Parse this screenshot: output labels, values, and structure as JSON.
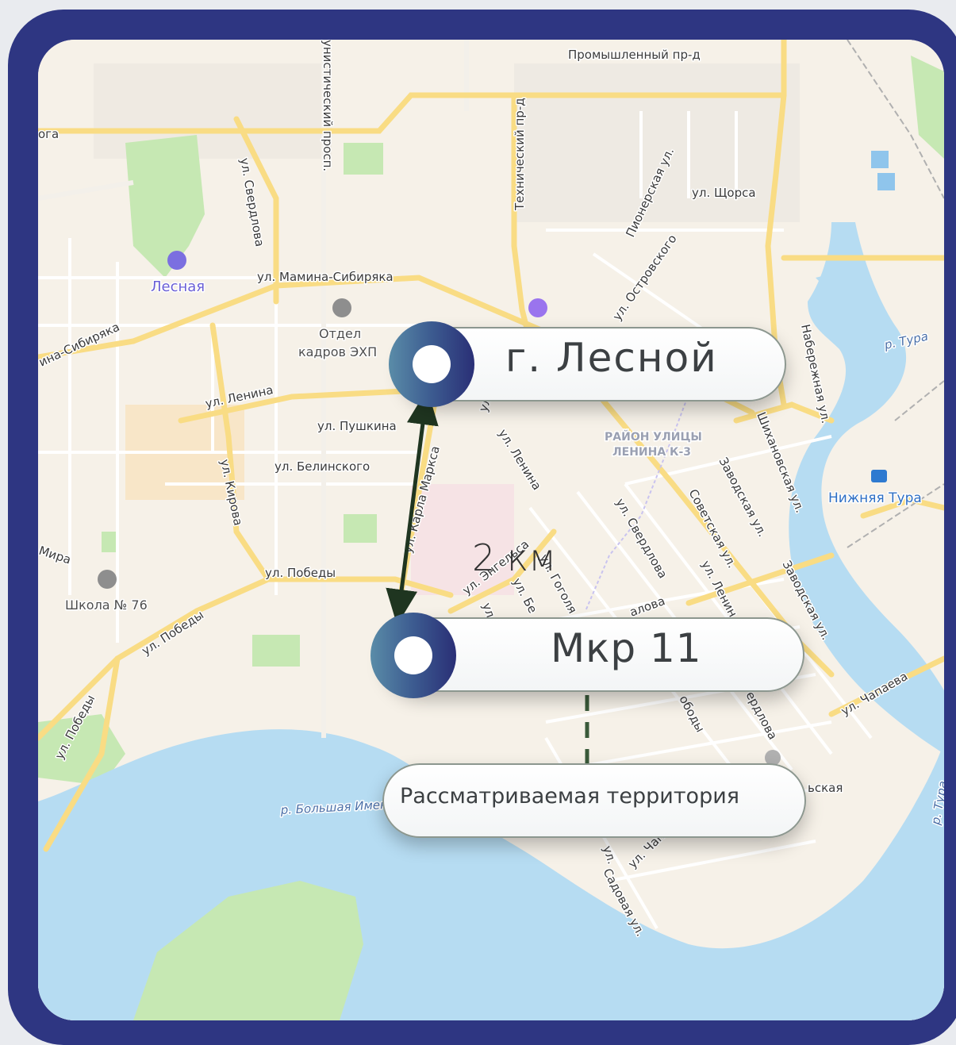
{
  "markers": {
    "lesnoy": {
      "label": "г. Лесной"
    },
    "mkr11": {
      "label": "Мкр 11"
    },
    "territory": {
      "label": "Рассматриваемая  территория"
    }
  },
  "distance": {
    "label": "2 км"
  },
  "map_labels": {
    "street_promyshlenny": "Промышленный пр-д",
    "street_kommunistichesky": "унистический просп.",
    "street_tekhnichesky": "Технический пр-д",
    "street_ga": "ога",
    "street_sverdlova_left": "ул. Свердлова",
    "street_pionerskaya": "Пионерская ул.",
    "street_shchorsa": "ул. Щорса",
    "street_ostrovskogo": "ул. Островского",
    "street_mamina": "ул. Мамина-Сибиряка",
    "street_mamina_left": "ина-Сибиряка",
    "street_lenina_left": "ул. Ленина",
    "street_pushkina": "ул. Пушкина",
    "street_belinskogo": "ул. Белинского",
    "street_kirova": "ул. Кирова",
    "street_karla_marksa": "ул. Карла Маркса",
    "street_lenina_mid": "ул. Ленина",
    "street_ul": "ул.",
    "street_engelsa": "ул. Энгельса",
    "street_pobedy": "ул. Победы",
    "street_pobedy_sw": "ул. Победы",
    "street_pobedy_far": "ул. Победы",
    "street_mira": "Мира",
    "street_gogolya": "ул. Гоголя",
    "street_be": "ул. Бе",
    "street_ul2": "ул.",
    "street_sverdlova_mid": "ул. Свердлова",
    "street_chalova": "алова",
    "street_sovetskaya": "Советская ул.",
    "street_zavodskaya1": "Заводская ул.",
    "street_zavodskaya2": "Заводская ул.",
    "street_lenin_right": "ул. Ленин",
    "street_shikhanovskaya": "Шихановская ул.",
    "street_naberezhnaya": "Набережная ул.",
    "street_chapaeva": "ул. Чапаева",
    "street_erdlova": "ердлова",
    "street_obody": "ободы",
    "street_skaya": "ьская",
    "street_chap": "ул. Чапа",
    "street_ul3": "ул.",
    "street_sadovaya": "Садовая ул.",
    "district": "РАЙОН УЛИЦЫ",
    "district2": "ЛЕНИНА К-3",
    "river_tura": "р. Тура",
    "river_tura2": "р. Тура",
    "river_imennaya": "р. Большая Именная",
    "poi_lesnaya": "Лесная",
    "poi_otdel": "Отдел",
    "poi_otdel2": "кадров ЭХП",
    "poi_shkola": "Школа № 76",
    "poi_nizhnyaya_tura": "Нижняя Тура"
  },
  "colors": {
    "frame": "#2e3682",
    "water": "#b6dcf2",
    "park": "#c6e8b3",
    "road_major": "#f9dc84",
    "route_arrow": "#1f3520"
  }
}
